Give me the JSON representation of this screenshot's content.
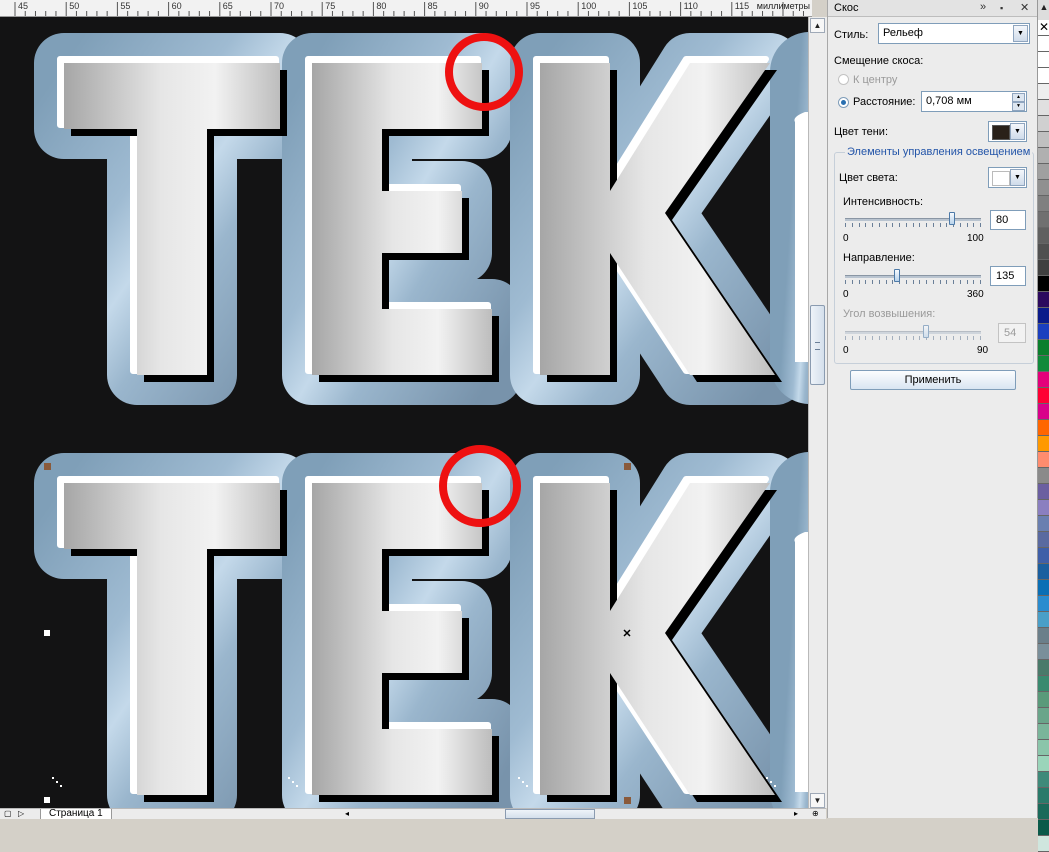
{
  "ruler": {
    "numbers": [
      "45",
      "50",
      "55",
      "60",
      "65",
      "70",
      "75",
      "80",
      "85",
      "90",
      "95",
      "100",
      "105",
      "110",
      "115"
    ],
    "unit": "миллиметры"
  },
  "canvas": {
    "artwork_text_top": "ТЕК",
    "artwork_text_bottom": "ТЕК",
    "highlight_color": "#ee1111"
  },
  "bottombar": {
    "page_tab": "Страница 1"
  },
  "docker": {
    "title": "Скос",
    "title_controls": {
      "expand": "»",
      "menu": "▪",
      "close": "✕"
    },
    "style_label": "Стиль:",
    "style_value": "Рельеф",
    "offset_label": "Смещение скоса:",
    "to_center_label": "К центру",
    "distance_label": "Расстояние:",
    "distance_value": "0,708 мм",
    "shadow_color_label": "Цвет тени:",
    "shadow_color": "#2a2119",
    "lighting_group_title": "Элементы управления освещением",
    "light_color_label": "Цвет света:",
    "light_color": "#ffffff",
    "intensity": {
      "label": "Интенсивность:",
      "value": "80",
      "min": "0",
      "max": "100",
      "fraction": 0.8
    },
    "direction": {
      "label": "Направление:",
      "value": "135",
      "min": "0",
      "max": "360",
      "fraction": 0.375
    },
    "altitude": {
      "label": "Угол возвышения:",
      "value": "54",
      "min": "0",
      "max": "90",
      "fraction": 0.6
    },
    "apply_button": "Применить"
  },
  "palette": {
    "colors": [
      "#ffffff",
      "#ffffff",
      "#ffffff",
      "#eeeeee",
      "#e0e0e0",
      "#d0d0d0",
      "#c0c0c0",
      "#b0b0b0",
      "#a0a0a0",
      "#909090",
      "#808080",
      "#707070",
      "#606060",
      "#505050",
      "#404040",
      "#000000",
      "#2c0a5e",
      "#0a1a8a",
      "#1b3fbf",
      "#0a7f2d",
      "#118a3b",
      "#e3007a",
      "#ff0033",
      "#d9008a",
      "#ff6600",
      "#ff9900",
      "#ff8c6e",
      "#8a8a8a",
      "#6b5fa0",
      "#8a7fc0",
      "#6a7fb0",
      "#5a6aa0",
      "#3f5fa8",
      "#1a5f9f",
      "#0a6fb5",
      "#2a8ccf",
      "#4a9fc8",
      "#6b7f8a",
      "#7a8f9a",
      "#4a7a6a",
      "#3a8a6f",
      "#5a9a7a",
      "#6aa58a",
      "#7ab59a",
      "#8ac5aa",
      "#9ad5ba",
      "#3f8a7a",
      "#2a7a6a",
      "#1a6a5a",
      "#0a5a4a",
      "#cfe6de"
    ]
  }
}
